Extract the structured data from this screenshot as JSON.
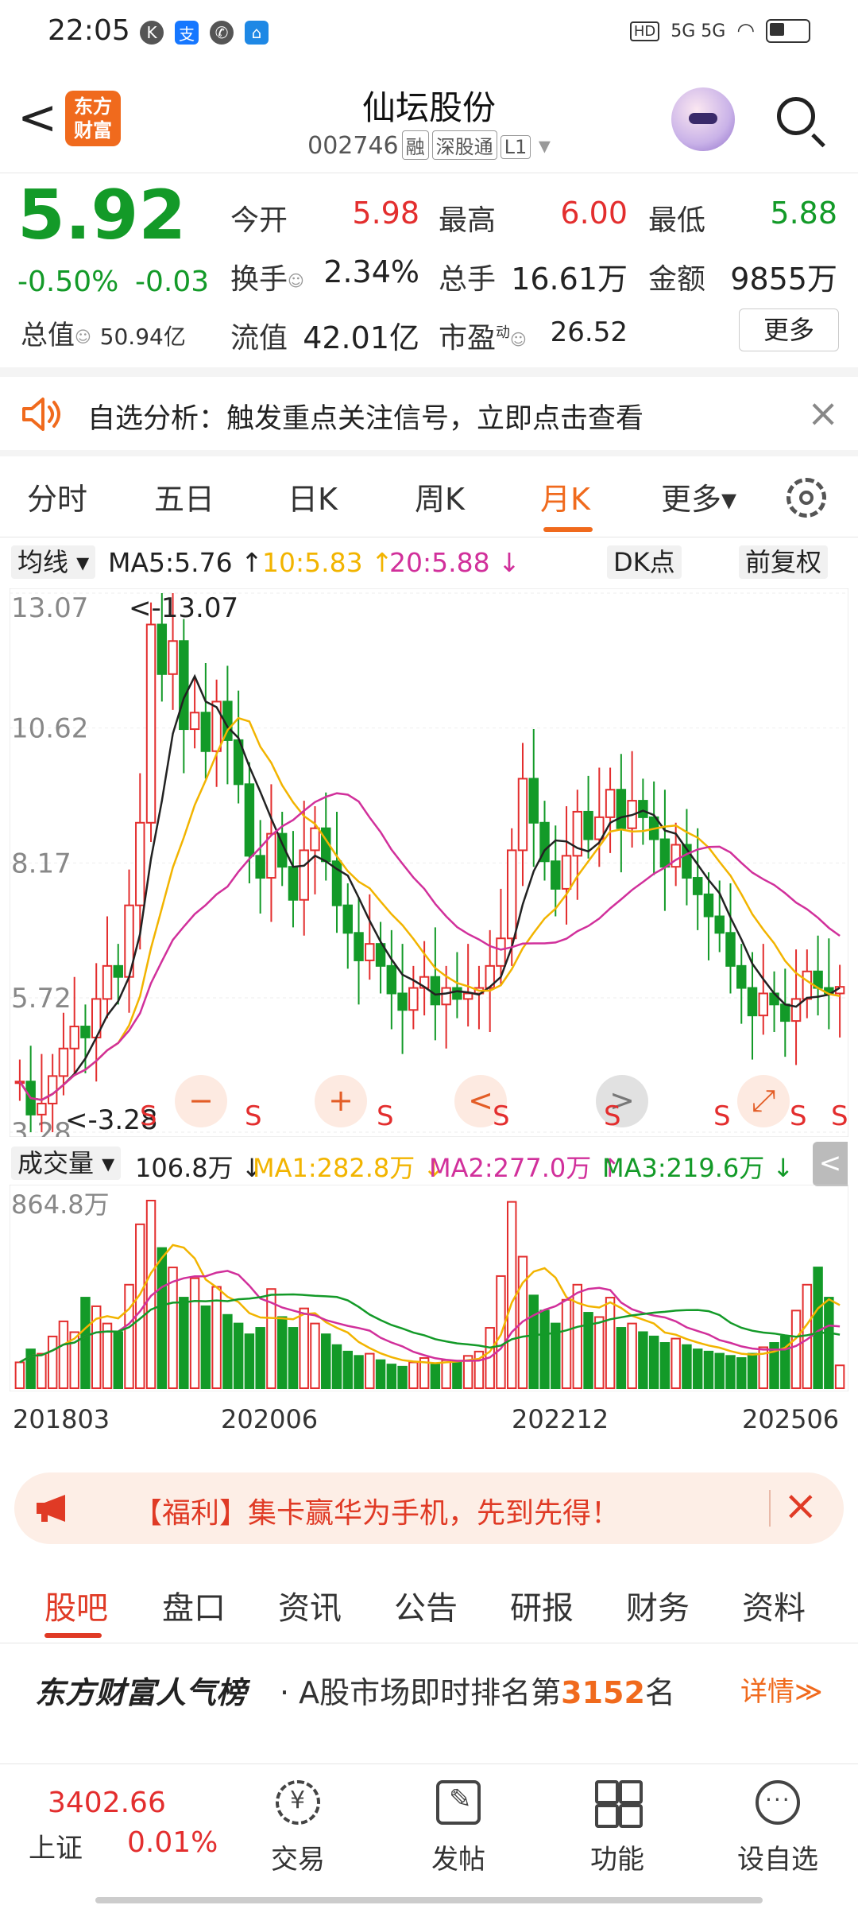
{
  "status_bar": {
    "time": "22:05",
    "network": "5G 5G",
    "hd_label": "HD"
  },
  "header": {
    "back_label": "<",
    "logo_text_1": "东方",
    "logo_text_2": "财富",
    "stock_name": "仙坛股份",
    "stock_code": "002746",
    "tag_rong": "融",
    "tag_sgt": "深股通",
    "tag_level": "L1"
  },
  "quote": {
    "price": "5.92",
    "change_pct": "-0.50%",
    "change": "-0.03",
    "open_label": "今开",
    "open": "5.98",
    "high_label": "最高",
    "high": "6.00",
    "low_label": "最低",
    "low": "5.88",
    "turnover_label": "换手",
    "turnover": "2.34%",
    "volume_label": "总手",
    "volume": "16.61万",
    "amount_label": "金额",
    "amount": "9855万",
    "mktcap_label": "总值",
    "mktcap": "50.94亿",
    "float_label": "流值",
    "float": "42.01亿",
    "pe_label": "市盈",
    "pe_sup": "动",
    "pe": "26.52",
    "more_label": "更多",
    "colors": {
      "up": "#e32e2e",
      "down": "#139a28",
      "accent": "#f06a1d"
    }
  },
  "notice": {
    "text": "自选分析：触发重点关注信号，立即点击查看",
    "close": "×"
  },
  "tabs": [
    "分时",
    "五日",
    "日K",
    "周K",
    "月K",
    "更多▾"
  ],
  "active_tab": "月K",
  "ma": {
    "toggle": "均线 ▾",
    "ma5": "MA5:5.76 ↑",
    "ma10": "10:5.83 ↑",
    "ma20": "20:5.88 ↓",
    "dk": "DK点",
    "adjust": "前复权"
  },
  "chart_controls": {
    "minus": "−",
    "plus": "+",
    "left": "<",
    "right": ">",
    "expand": "⤢",
    "flag": "S"
  },
  "volume_row": {
    "toggle": "成交量 ▾",
    "vol": "106.8万 ↓",
    "ma1": "MA1:282.8万 ↓",
    "ma2": "MA2:277.0万 ↑",
    "ma3": "MA3:219.6万 ↓",
    "handle": "<"
  },
  "chart_data": {
    "type": "candlestick",
    "period": "monthly",
    "y_ticks": [
      "13.07",
      "10.62",
      "8.17",
      "5.72",
      "3.28"
    ],
    "ylim": [
      3.28,
      13.07
    ],
    "max_label": "<-13.07",
    "min_label": "<-3.28",
    "x_ticks": [
      "201803",
      "202006",
      "202212",
      "202506"
    ],
    "volume_y_tick": "864.8万",
    "close_series": [
      4.2,
      3.6,
      3.8,
      4.3,
      4.8,
      5.2,
      5.0,
      5.7,
      6.3,
      6.1,
      7.4,
      8.9,
      12.5,
      11.6,
      12.2,
      10.6,
      10.9,
      10.2,
      11.1,
      10.4,
      9.6,
      8.3,
      7.9,
      8.7,
      8.1,
      7.5,
      8.4,
      8.8,
      8.2,
      7.4,
      6.9,
      6.4,
      6.7,
      6.3,
      5.8,
      5.5,
      5.9,
      6.1,
      5.6,
      5.9,
      5.7,
      5.8,
      5.9,
      6.3,
      6.8,
      8.4,
      9.7,
      8.9,
      8.2,
      7.7,
      8.3,
      9.1,
      8.6,
      9.0,
      9.5,
      8.8,
      9.3,
      9.0,
      8.6,
      8.1,
      8.5,
      7.9,
      7.6,
      7.2,
      6.9,
      6.3,
      5.9,
      5.4,
      5.8,
      5.6,
      5.3,
      5.7,
      6.2,
      5.9,
      5.8,
      5.92
    ],
    "volume_series": [
      120,
      180,
      160,
      240,
      310,
      260,
      420,
      380,
      300,
      260,
      480,
      760,
      870,
      650,
      560,
      420,
      510,
      380,
      470,
      340,
      300,
      250,
      280,
      460,
      330,
      280,
      370,
      300,
      250,
      200,
      170,
      150,
      160,
      130,
      110,
      100,
      120,
      140,
      110,
      130,
      120,
      150,
      170,
      280,
      520,
      864,
      610,
      430,
      360,
      300,
      410,
      480,
      350,
      330,
      420,
      280,
      300,
      260,
      240,
      210,
      230,
      200,
      180,
      170,
      160,
      150,
      140,
      160,
      190,
      210,
      240,
      360,
      480,
      560,
      420,
      106
    ],
    "ma_colors": {
      "ma5": "#222222",
      "ma10": "#f2b400",
      "ma20": "#d1309b",
      "vol_ma3": "#139a28"
    }
  },
  "promo": {
    "text": "【福利】集卡赢华为手机，先到先得！",
    "close": "×"
  },
  "bottom_tabs": [
    "股吧",
    "盘口",
    "资讯",
    "公告",
    "研报",
    "财务",
    "资料"
  ],
  "rank": {
    "brand": "东方财富人气榜",
    "prefix": "· A股市场即时排名第",
    "number": "3152",
    "suffix": "名",
    "detail": "详情≫"
  },
  "bottom_nav": {
    "index_value": "3402.66",
    "index_name": "上证",
    "index_pct": "0.01%",
    "items": [
      "交易",
      "发帖",
      "功能",
      "设自选"
    ]
  }
}
